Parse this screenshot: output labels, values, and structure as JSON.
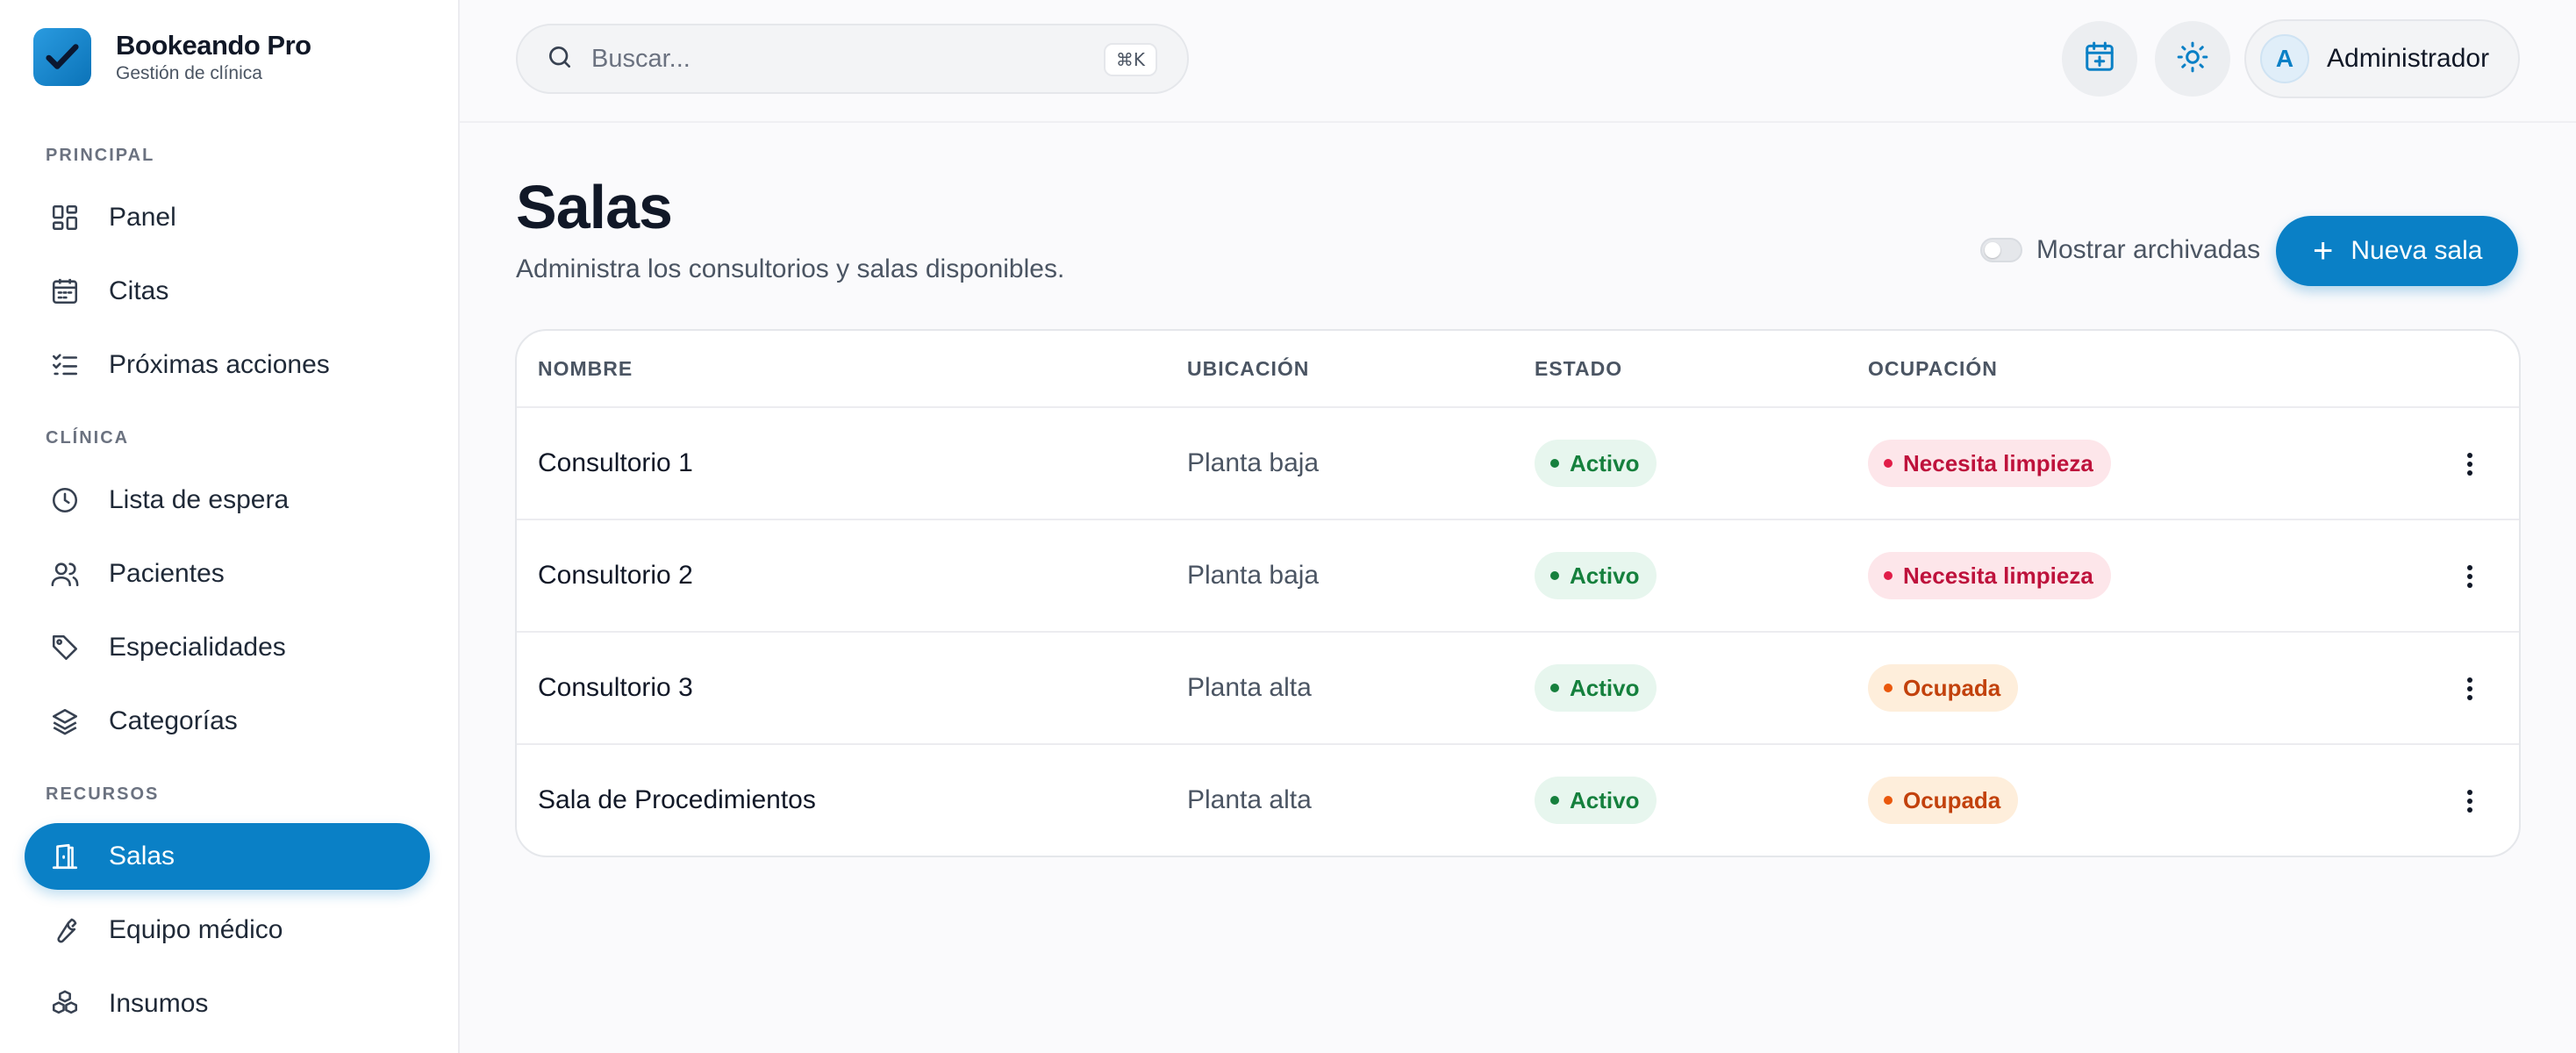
{
  "colors": {
    "accent": "#0a80c6",
    "success_bg": "#e7f6ee",
    "success_fg": "#15803d",
    "danger_bg": "#fde6ea",
    "danger_fg": "#be123c",
    "warning_bg": "#feeedb",
    "warning_fg": "#c2410c"
  },
  "brand": {
    "name": "Bookeando Pro",
    "subtitle": "Gestión de clínica",
    "icon": "check-icon"
  },
  "sidebar": {
    "sections": [
      {
        "label": "PRINCIPAL",
        "items": [
          {
            "label": "Panel",
            "icon": "dashboard-icon"
          },
          {
            "label": "Citas",
            "icon": "calendar-icon"
          },
          {
            "label": "Próximas acciones",
            "icon": "checklist-icon"
          }
        ]
      },
      {
        "label": "CLÍNICA",
        "items": [
          {
            "label": "Lista de espera",
            "icon": "clock-icon"
          },
          {
            "label": "Pacientes",
            "icon": "users-icon"
          },
          {
            "label": "Especialidades",
            "icon": "tag-icon"
          },
          {
            "label": "Categorías",
            "icon": "layers-icon"
          }
        ]
      },
      {
        "label": "RECURSOS",
        "items": [
          {
            "label": "Salas",
            "icon": "door-icon",
            "active": true
          },
          {
            "label": "Equipo médico",
            "icon": "wrench-icon"
          },
          {
            "label": "Insumos",
            "icon": "boxes-icon"
          }
        ]
      }
    ]
  },
  "header": {
    "search_placeholder": "Buscar...",
    "search_shortcut": "⌘K",
    "user_initial": "A",
    "user_name": "Administrador"
  },
  "page": {
    "title": "Salas",
    "subtitle": "Administra los consultorios y salas disponibles.",
    "toggle_label": "Mostrar archivadas",
    "toggle_on": false,
    "new_button_label": "Nueva sala"
  },
  "table": {
    "columns": [
      "NOMBRE",
      "UBICACIÓN",
      "ESTADO",
      "OCUPACIÓN"
    ],
    "rows": [
      {
        "name": "Consultorio 1",
        "location": "Planta baja",
        "status": "Activo",
        "occupancy": "Necesita limpieza",
        "occupancy_tone": "red"
      },
      {
        "name": "Consultorio 2",
        "location": "Planta baja",
        "status": "Activo",
        "occupancy": "Necesita limpieza",
        "occupancy_tone": "red"
      },
      {
        "name": "Consultorio 3",
        "location": "Planta alta",
        "status": "Activo",
        "occupancy": "Ocupada",
        "occupancy_tone": "orange"
      },
      {
        "name": "Sala de Procedimientos",
        "location": "Planta alta",
        "status": "Activo",
        "occupancy": "Ocupada",
        "occupancy_tone": "orange"
      }
    ]
  }
}
